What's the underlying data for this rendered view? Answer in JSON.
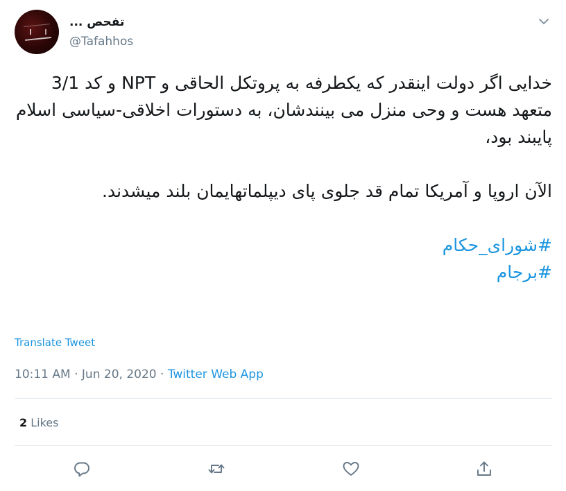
{
  "author": {
    "display_name": "تفحص ...",
    "handle": "@Tafahhos",
    "avatar_icon": "avatar-image"
  },
  "tweet": {
    "paragraph1": "خدایی اگر دولت اینقدر که یکطرفه به پروتکل الحاقی و NPT و کد 3/1 متعهد هست و وحی منزل می بینندشان، به دستورات اخلاقی-سیاسی اسلام پایبند بود،",
    "paragraph2": "الآن اروپا و آمریکا تمام قد جلوی پای دیپلماتهایمان بلند میشدند.",
    "hashtags": [
      "#شورای_حکام",
      "#برجام"
    ]
  },
  "translate_label": "Translate Tweet",
  "meta": {
    "time": "10:11 AM",
    "separator": " · ",
    "date": "Jun 20, 2020",
    "app": "Twitter Web App"
  },
  "stats": {
    "likes_count": "2",
    "likes_label": "Likes"
  },
  "actions": {
    "reply_icon": "reply-icon",
    "retweet_icon": "retweet-icon",
    "like_icon": "like-icon",
    "share_icon": "share-icon",
    "more_icon": "chevron-down-icon"
  },
  "colors": {
    "link": "#1b95e0",
    "text": "#14171a",
    "secondary": "#657786",
    "divider": "#e6ecf0"
  }
}
